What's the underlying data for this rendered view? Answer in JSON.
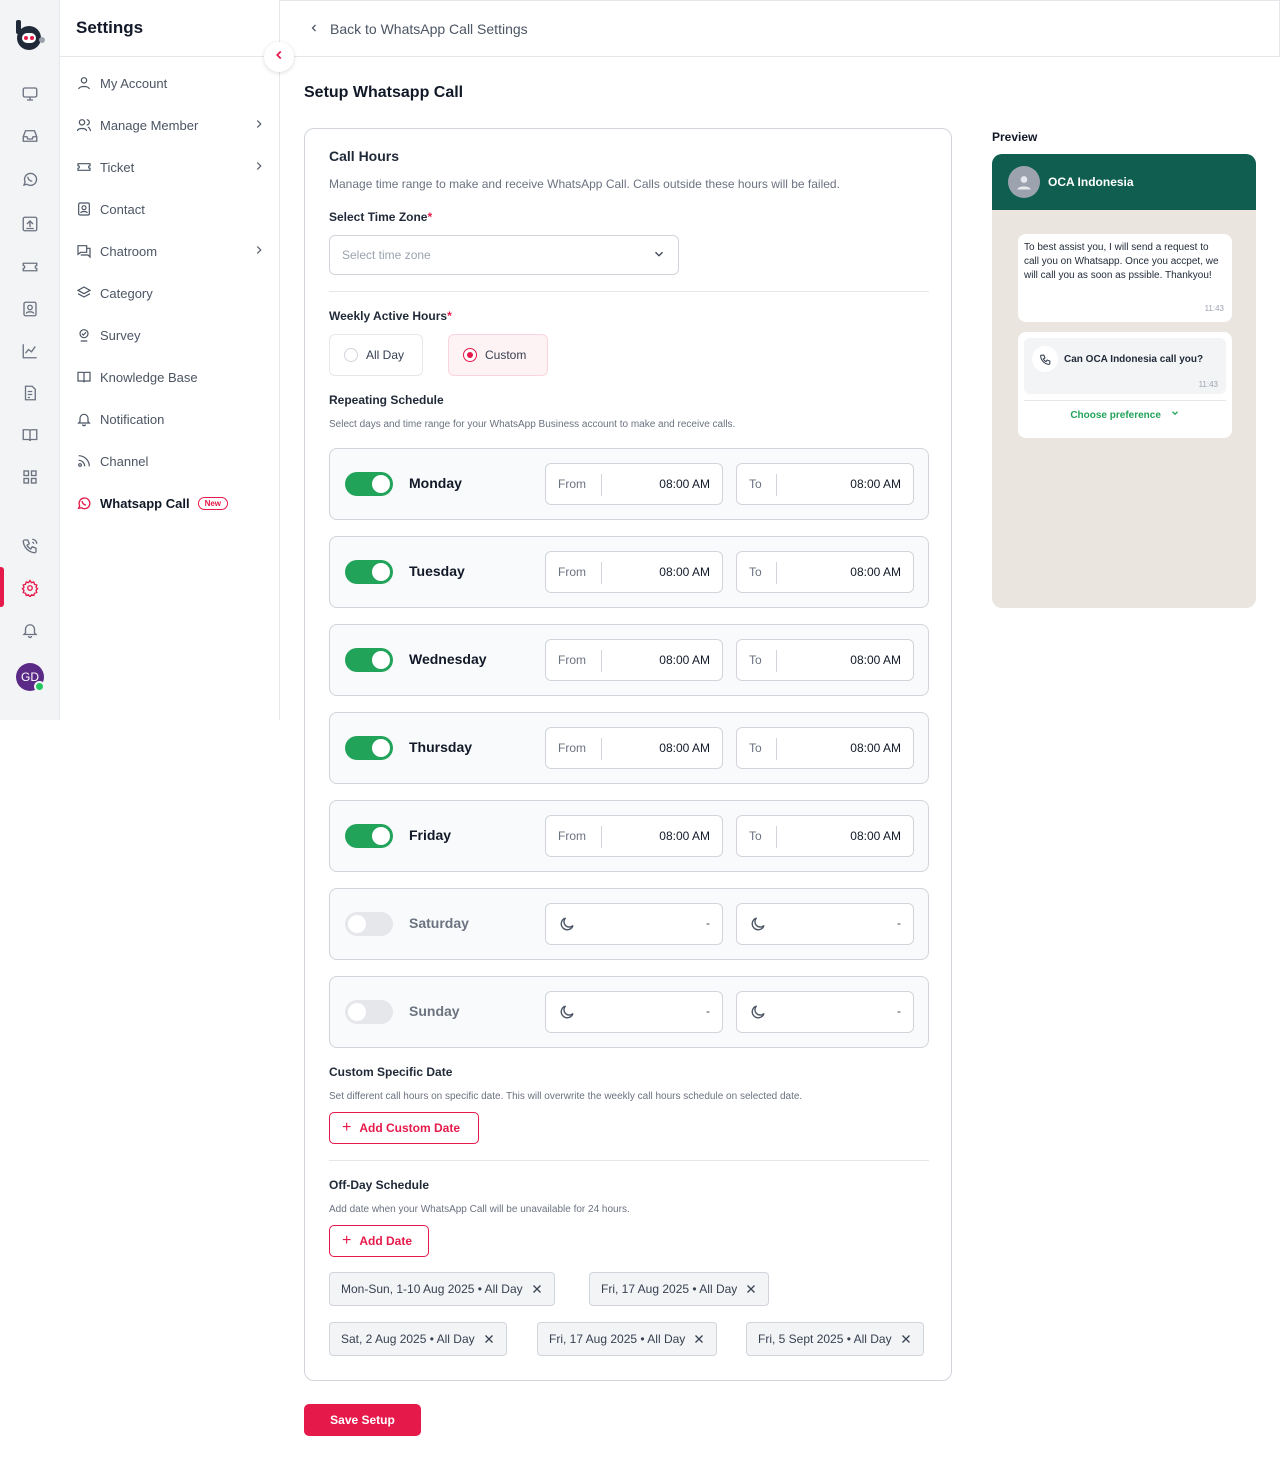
{
  "app": {
    "avatar_initials": "GD",
    "brand_color": "#e6194b",
    "success_color": "#22a35a"
  },
  "rail": {
    "icons": [
      "monitor-icon",
      "inbox-icon",
      "whatsapp-icon",
      "upload-icon",
      "ticket-icon",
      "contact-icon",
      "chart-icon",
      "report-icon",
      "book-icon",
      "grid-icon",
      "phone-icon",
      "settings-icon",
      "bell-icon"
    ],
    "active": "settings-icon"
  },
  "menu": {
    "title": "Settings",
    "items": [
      {
        "label": "My Account",
        "icon": "user-icon"
      },
      {
        "label": "Manage Member",
        "icon": "users-icon",
        "chevron": true
      },
      {
        "label": "Ticket",
        "icon": "ticket-icon",
        "chevron": true
      },
      {
        "label": "Contact",
        "icon": "contact-icon"
      },
      {
        "label": "Chatroom",
        "icon": "chat-icon",
        "chevron": true
      },
      {
        "label": "Category",
        "icon": "layers-icon"
      },
      {
        "label": "Survey",
        "icon": "survey-icon"
      },
      {
        "label": "Knowledge Base",
        "icon": "book-icon"
      },
      {
        "label": "Notification",
        "icon": "bell-icon"
      },
      {
        "label": "Channel",
        "icon": "rss-icon"
      },
      {
        "label": "Whatsapp Call",
        "icon": "whatsapp-icon",
        "badge": "New",
        "active": true
      }
    ]
  },
  "header": {
    "back_label": "Back to WhatsApp Call Settings"
  },
  "page": {
    "title": "Setup Whatsapp Call"
  },
  "call_hours": {
    "title": "Call Hours",
    "description": "Manage time range to make and receive WhatsApp Call. Calls outside these hours will be failed.",
    "timezone_label": "Select Time Zone",
    "required_mark": "*",
    "timezone_placeholder": "Select time zone",
    "weekly_label": "Weekly Active Hours",
    "options": {
      "all_day": "All Day",
      "custom": "Custom",
      "selected": "Custom"
    }
  },
  "schedule": {
    "title": "Repeating Schedule",
    "description": "Select days and time range for your WhatsApp Business account to make and receive calls.",
    "from_label": "From",
    "to_label": "To",
    "off_value": "-",
    "days": [
      {
        "name": "Monday",
        "enabled": true,
        "from": "08:00 AM",
        "to": "08:00 AM"
      },
      {
        "name": "Tuesday",
        "enabled": true,
        "from": "08:00 AM",
        "to": "08:00 AM"
      },
      {
        "name": "Wednesday",
        "enabled": true,
        "from": "08:00 AM",
        "to": "08:00 AM"
      },
      {
        "name": "Thursday",
        "enabled": true,
        "from": "08:00 AM",
        "to": "08:00 AM"
      },
      {
        "name": "Friday",
        "enabled": true,
        "from": "08:00 AM",
        "to": "08:00 AM"
      },
      {
        "name": "Saturday",
        "enabled": false,
        "from": "-",
        "to": "-"
      },
      {
        "name": "Sunday",
        "enabled": false,
        "from": "-",
        "to": "-"
      }
    ]
  },
  "custom_date": {
    "title": "Custom Specific Date",
    "description": "Set different call hours on specific date. This will overwrite the weekly call hours schedule on selected date.",
    "button": "Add Custom Date"
  },
  "off_day": {
    "title": "Off-Day Schedule",
    "description": "Add date when your WhatsApp Call will be unavailable for 24 hours.",
    "button": "Add Date",
    "chips": [
      "Mon-Sun, 1-10 Aug 2025 • All Day",
      "Fri, 17 Aug 2025 • All Day",
      "Sat, 2 Aug 2025 • All Day",
      "Fri, 17 Aug 2025 • All Day",
      "Fri, 5 Sept 2025 • All Day"
    ]
  },
  "save_button": "Save Setup",
  "preview": {
    "label": "Preview",
    "contact_name": "OCA Indonesia",
    "message": "To best assist you, I will send a request to call you on Whatsapp. Once you accpet, we will call you as soon as pssible. Thankyou!",
    "message_time": "11:43",
    "call_prompt": "Can OCA Indonesia call you?",
    "call_time": "11:43",
    "preference": "Choose preference",
    "header_color": "#0f5e4f"
  }
}
